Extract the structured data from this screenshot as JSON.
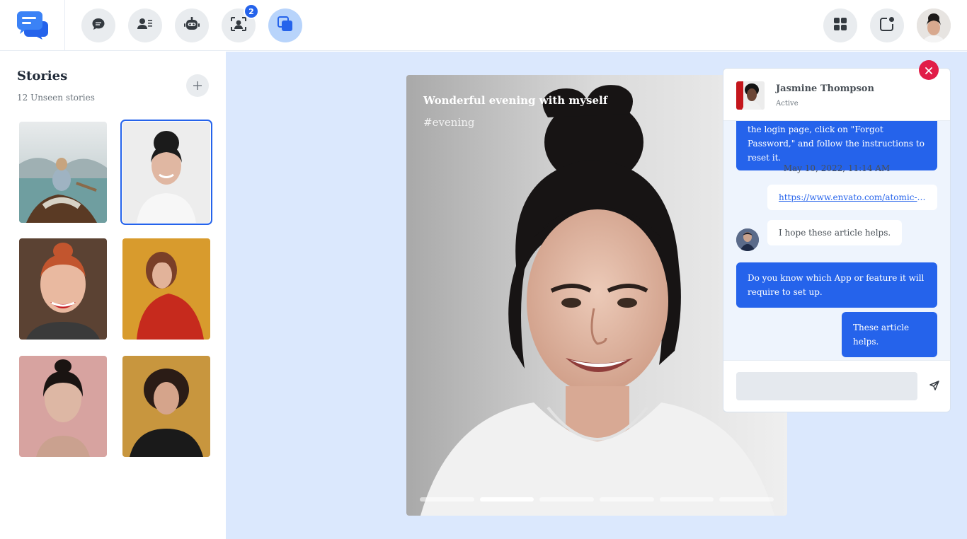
{
  "topbar": {
    "nav": [
      {
        "icon": "chat-icon"
      },
      {
        "icon": "contacts-icon"
      },
      {
        "icon": "bot-icon"
      },
      {
        "icon": "group-icon",
        "badge": "2"
      },
      {
        "icon": "stories-icon",
        "active": true
      }
    ],
    "right": [
      {
        "icon": "apps-grid-icon"
      },
      {
        "icon": "notification-icon"
      }
    ]
  },
  "stories": {
    "title": "Stories",
    "subtitle": "12 Unseen stories",
    "add_icon": "plus-icon",
    "selected_index": 1
  },
  "story_view": {
    "title": "Wonderful evening with myself",
    "tag": "#evening",
    "segments": 6,
    "active_segment": 2
  },
  "chat": {
    "name": "Jasmine Thompson",
    "status": "Active",
    "messages": {
      "m1": "the login page, click on \"Forgot Password,\" and follow the instructions to reset it.",
      "date": "May 10, 2022, 11:14 AM",
      "link": "https://www.envato.com/atomic-po...",
      "m2": "I hope these article helps.",
      "m3": "Do you know which App or feature it will require to set up.",
      "m4": "These article helps."
    },
    "input_placeholder": ""
  },
  "colors": {
    "accent": "#2563eb",
    "main_bg": "#dbe8fd",
    "close": "#e11d48"
  }
}
